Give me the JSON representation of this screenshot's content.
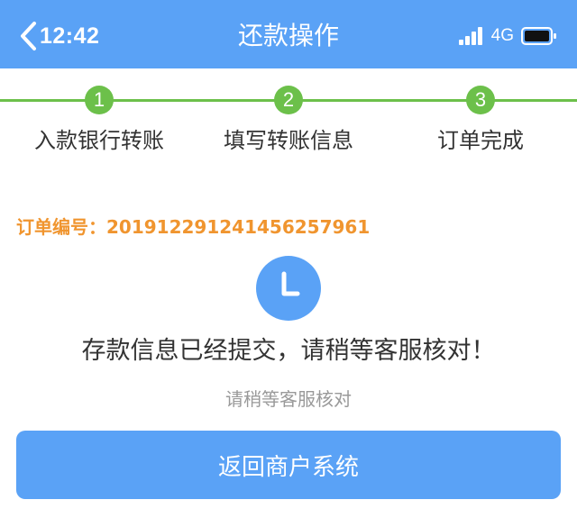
{
  "status_bar": {
    "time": "12:42",
    "network": "4G"
  },
  "header": {
    "title": "还款操作"
  },
  "steps": [
    {
      "number": "1",
      "label": "入款银行转账"
    },
    {
      "number": "2",
      "label": "填写转账信息"
    },
    {
      "number": "3",
      "label": "订单完成"
    }
  ],
  "order": {
    "text": "订单编号：20191229124145625​7961"
  },
  "message": {
    "main": "存款信息已经提交，请稍等客服核对！",
    "sub": "请稍等客服核对"
  },
  "button": {
    "label": "返回商户系统"
  },
  "colors": {
    "header": "#5aa2f6",
    "step": "#6cc04a",
    "order": "#f0952f",
    "button": "#5aa2f6"
  },
  "icons": {
    "back": "chevron-left-icon",
    "signal": "signal-icon",
    "battery": "battery-icon",
    "pending": "clock-icon"
  }
}
